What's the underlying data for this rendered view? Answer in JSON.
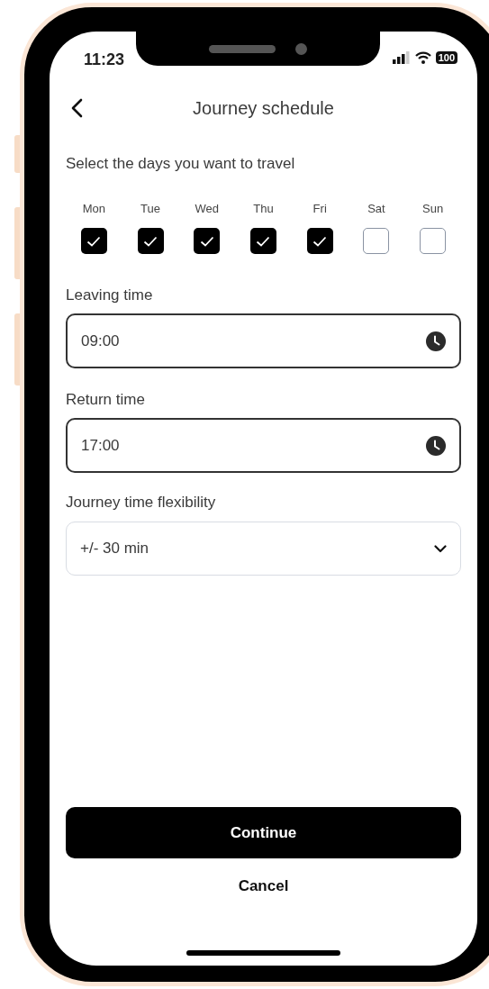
{
  "status_bar": {
    "time": "11:23",
    "battery": "100"
  },
  "header": {
    "title": "Journey schedule"
  },
  "days_prompt": "Select the days you want to travel",
  "days": [
    {
      "label": "Mon",
      "checked": true
    },
    {
      "label": "Tue",
      "checked": true
    },
    {
      "label": "Wed",
      "checked": true
    },
    {
      "label": "Thu",
      "checked": true
    },
    {
      "label": "Fri",
      "checked": true
    },
    {
      "label": "Sat",
      "checked": false
    },
    {
      "label": "Sun",
      "checked": false
    }
  ],
  "leaving_time": {
    "label": "Leaving time",
    "value": "09:00"
  },
  "return_time": {
    "label": "Return time",
    "value": "17:00"
  },
  "flexibility": {
    "label": "Journey time flexibility",
    "value": "+/- 30 min"
  },
  "buttons": {
    "continue": "Continue",
    "cancel": "Cancel"
  }
}
